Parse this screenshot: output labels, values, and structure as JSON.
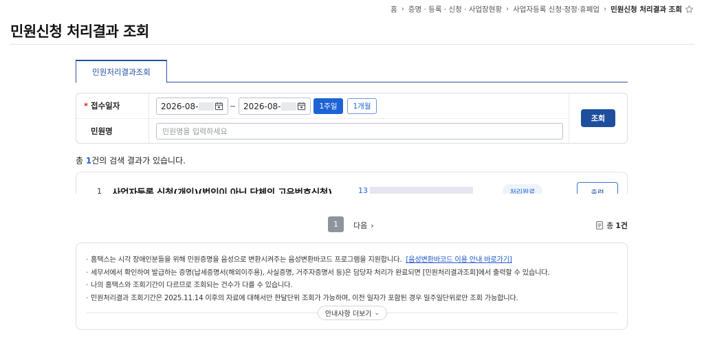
{
  "breadcrumb": {
    "items": [
      "홈",
      "증명 · 등록 · 신청 · 사업장현황",
      "사업자등록 신청·정정·휴폐업"
    ],
    "current": "민원신청 처리결과 조회"
  },
  "page": {
    "title": "민원신청 처리결과 조회"
  },
  "tabs": [
    {
      "label": "민원처리결과조회",
      "active": true
    }
  ],
  "search": {
    "date_label": "접수일자",
    "required_mark": "*",
    "start_date": "2026-08-",
    "end_date": "2026-08-",
    "range_separator": "~",
    "week_button": "1주일",
    "month_button": "1개월",
    "name_label": "민원명",
    "name_placeholder": "민원명을 입력하세요",
    "search_button": "조회"
  },
  "results": {
    "summary_prefix": "총 ",
    "count": "1",
    "summary_suffix": "건의 검색 결과가 있습니다.",
    "rows": [
      {
        "index": "1",
        "title": "사업자등록 신청(개인)(법인이 아닌 단체의 고유번호신청)",
        "receipt_no_prefix": "13",
        "status": "처리완료",
        "action": "출력"
      }
    ]
  },
  "pagination": {
    "current": "1",
    "next_label": "다음",
    "total_prefix": "총",
    "total_value": "1건"
  },
  "notice": {
    "items": [
      "홈택스는 시각 장애인분들을 위해 민원증명을 음성으로 변환시켜주는 음성변환바코드 프로그램을 지원합니다.",
      "세무서에서 확인하여 발급하는 증명(납세증명서(해외이주용), 사실증명, 거주자증명서 등)은 담당자 처리가 완료되면 [민원처리결과조회]에서 출력할 수 있습니다.",
      "나의 홈택스와 조회기간이 다르므로 조회되는 건수가 다를 수 있습니다.",
      "민원처리결과 조회기간은 2025.11.14 이후의 자료에 대해서만 한달단위 조회가 가능하며, 이전 일자가 포함된 경우 일주일단위로만 조회 가능합니다."
    ],
    "link_text": "[음성변환바코드 이용 안내 바로가기]",
    "more_button": "안내사항 더보기"
  },
  "icons": {
    "calendar": "calendar-icon",
    "star": "star-icon",
    "document": "document-icon",
    "chevron_right": "chevron-right-icon",
    "chevron_down": "chevron-down-icon"
  },
  "colors": {
    "primary": "#1e63d6",
    "primary_dark": "#1d4f9e",
    "required": "#d22222",
    "status_bg": "#eef3fb"
  }
}
